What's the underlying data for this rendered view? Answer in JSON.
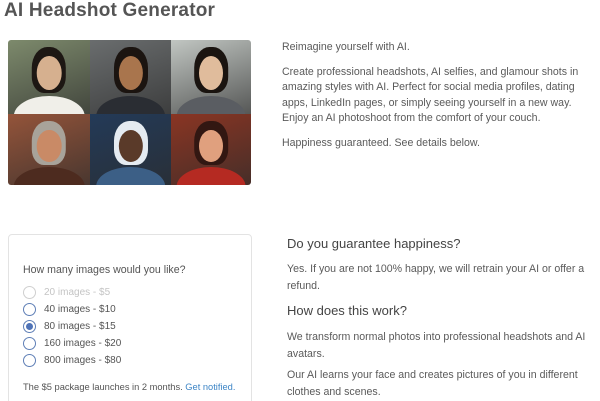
{
  "page": {
    "title": "AI Headshot Generator"
  },
  "gallery": {
    "tiles": [
      {
        "name": "headshot-woman-street",
        "bg": "#7d8a6c",
        "skin": "#d6b08f",
        "hair": "#1d1713",
        "cloth": "#f0efe9"
      },
      {
        "name": "headshot-man-suit",
        "bg": "#6a6d6e",
        "skin": "#a9754d",
        "hair": "#1b1410",
        "cloth": "#2a2d33"
      },
      {
        "name": "headshot-woman-blazer",
        "bg": "#c1c6c2",
        "skin": "#e0bc9c",
        "hair": "#1a1410",
        "cloth": "#5a5d62"
      },
      {
        "name": "avatar-bearded-warrior",
        "bg": "#94543a",
        "skin": "#c98a66",
        "hair": "#a8a39a",
        "cloth": "#4d2b1f"
      },
      {
        "name": "avatar-white-haired-sage",
        "bg": "#233a58",
        "skin": "#5a3a29",
        "hair": "#e5ebf1",
        "cloth": "#3c5f86"
      },
      {
        "name": "avatar-wonder-woman",
        "bg": "#8a3523",
        "skin": "#e0a07e",
        "hair": "#321712",
        "cloth": "#b52a22"
      }
    ]
  },
  "intro": {
    "line1": "Reimagine yourself with AI.",
    "line2": "Create professional headshots, AI selfies, and glamour shots in amazing styles with AI. Perfect for social media profiles, dating apps, LinkedIn pages, or simply seeing yourself in a new way. Enjoy an AI photoshoot from the comfort of your couch.",
    "line3": "Happiness guaranteed. See details below."
  },
  "pricing": {
    "question": "How many images would you like?",
    "options": [
      {
        "label": "20 images - $5",
        "disabled": true,
        "selected": false
      },
      {
        "label": "40 images - $10",
        "disabled": false,
        "selected": false
      },
      {
        "label": "80 images - $15",
        "disabled": false,
        "selected": true
      },
      {
        "label": "160 images - $20",
        "disabled": false,
        "selected": false
      },
      {
        "label": "800 images - $80",
        "disabled": false,
        "selected": false
      }
    ],
    "launch_text": "The $5 package launches in 2 months.",
    "launch_link": "Get notified."
  },
  "faq": [
    {
      "q": "Do you guarantee happiness?",
      "a": "Yes. If you are not 100% happy, we will retrain your AI or offer a refund."
    },
    {
      "q": "How does this work?",
      "a": "We transform normal photos into professional headshots and AI avatars.",
      "a2": "Our AI learns your face and creates pictures of you in different clothes and scenes."
    }
  ]
}
